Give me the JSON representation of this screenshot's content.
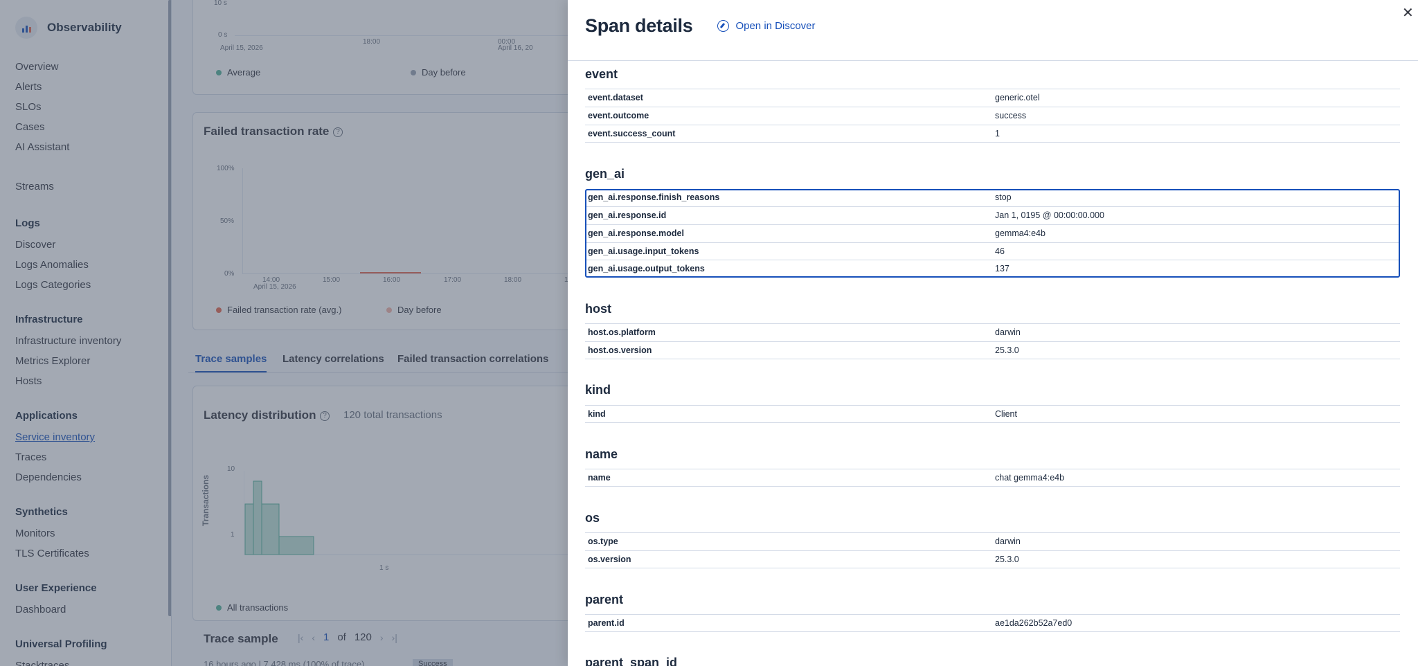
{
  "sidebar": {
    "brand": "Observability",
    "top_items": [
      "Overview",
      "Alerts",
      "SLOs",
      "Cases",
      "AI Assistant"
    ],
    "streams": "Streams",
    "sections": [
      {
        "title": "Logs",
        "items": [
          "Discover",
          "Logs Anomalies",
          "Logs Categories"
        ]
      },
      {
        "title": "Infrastructure",
        "items": [
          "Infrastructure inventory",
          "Metrics Explorer",
          "Hosts"
        ]
      },
      {
        "title": "Applications",
        "items": [
          "Service inventory",
          "Traces",
          "Dependencies"
        ]
      },
      {
        "title": "Synthetics",
        "items": [
          "Monitors",
          "TLS Certificates"
        ]
      },
      {
        "title": "User Experience",
        "items": [
          "Dashboard"
        ]
      },
      {
        "title": "Universal Profiling",
        "items": [
          "Stacktraces"
        ]
      }
    ],
    "active_item": "Service inventory"
  },
  "background": {
    "latency_chart": {
      "y_ticks": [
        "10 s",
        "0 s"
      ],
      "x_ticks": [
        "April 15, 2026",
        "18:00",
        "00:00",
        "April 16, 20"
      ],
      "legend": [
        "Average",
        "Day before"
      ]
    },
    "failed_rate": {
      "title": "Failed transaction rate",
      "y_ticks": [
        "100%",
        "50%",
        "0%"
      ],
      "x_ticks": [
        "14:00",
        "15:00",
        "16:00",
        "17:00",
        "18:00",
        "1"
      ],
      "x_date": "April 15, 2026",
      "legend": [
        "Failed transaction rate (avg.)",
        "Day before"
      ]
    },
    "tabs": [
      "Trace samples",
      "Latency correlations",
      "Failed transaction correlations"
    ],
    "latency_distribution": {
      "title": "Latency distribution",
      "total": "120 total transactions",
      "y_label": "Transactions",
      "y_ticks": [
        "10",
        "1"
      ],
      "x_tick": "1 s",
      "legend": "All transactions"
    },
    "trace_sample": {
      "title": "Trace sample",
      "current": "1",
      "of": "of",
      "total": "120",
      "meta": "16 hours ago  |  7,428 ms  (100% of trace)",
      "badge": "Success"
    }
  },
  "flyout": {
    "title": "Span details",
    "discover_link": "Open in Discover",
    "groups": [
      {
        "title": "event",
        "fields": [
          {
            "key": "event.dataset",
            "value": "generic.otel"
          },
          {
            "key": "event.outcome",
            "value": "success"
          },
          {
            "key": "event.success_count",
            "value": "1"
          }
        ]
      },
      {
        "title": "gen_ai",
        "fields": [
          {
            "key": "gen_ai.response.finish_reasons",
            "value": "stop"
          },
          {
            "key": "gen_ai.response.id",
            "value": "Jan 1, 0195 @ 00:00:00.000"
          },
          {
            "key": "gen_ai.response.model",
            "value": "gemma4:e4b"
          },
          {
            "key": "gen_ai.usage.input_tokens",
            "value": "46"
          },
          {
            "key": "gen_ai.usage.output_tokens",
            "value": "137"
          }
        ]
      },
      {
        "title": "host",
        "fields": [
          {
            "key": "host.os.platform",
            "value": "darwin"
          },
          {
            "key": "host.os.version",
            "value": "25.3.0"
          }
        ]
      },
      {
        "title": "kind",
        "fields": [
          {
            "key": "kind",
            "value": "Client"
          }
        ]
      },
      {
        "title": "name",
        "fields": [
          {
            "key": "name",
            "value": "chat gemma4:e4b"
          }
        ]
      },
      {
        "title": "os",
        "fields": [
          {
            "key": "os.type",
            "value": "darwin"
          },
          {
            "key": "os.version",
            "value": "25.3.0"
          }
        ]
      },
      {
        "title": "parent",
        "fields": [
          {
            "key": "parent.id",
            "value": "ae1da262b52a7ed0"
          }
        ]
      },
      {
        "title": "parent_span_id",
        "fields": []
      }
    ],
    "colors": {
      "accent": "#1750ba",
      "border": "#d3dae6",
      "text": "#1d2a3e"
    }
  }
}
